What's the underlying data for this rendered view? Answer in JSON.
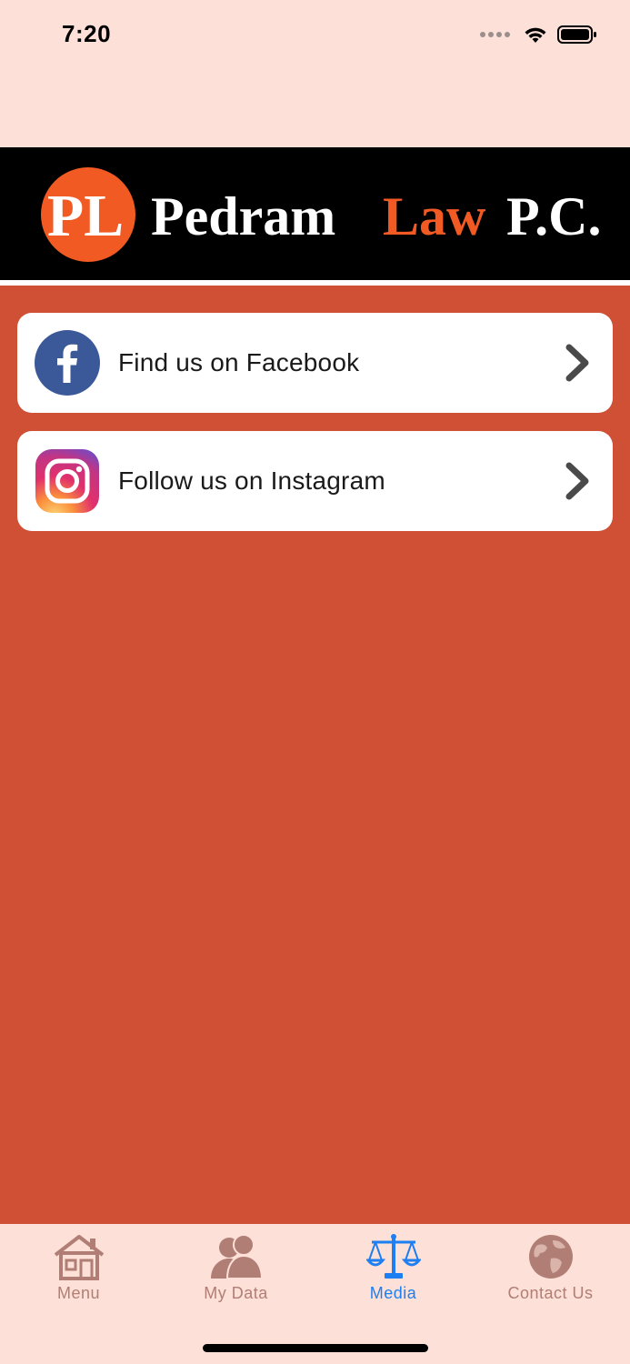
{
  "status_bar": {
    "time": "7:20",
    "icons": [
      "signal-dots-icon",
      "wifi-icon",
      "battery-icon"
    ]
  },
  "header": {
    "logo": {
      "monogram": "PL",
      "word_1": "Pedram",
      "word_2": "Law",
      "word_3": "P.C.",
      "colors": {
        "background": "#000000",
        "accent": "#f15a22",
        "text": "#ffffff"
      }
    }
  },
  "links": [
    {
      "label": "Find us on Facebook",
      "icon": "facebook-icon",
      "trailing_icon": "chevron-right-icon"
    },
    {
      "label": "Follow us on Instagram",
      "icon": "instagram-icon",
      "trailing_icon": "chevron-right-icon"
    }
  ],
  "tab_bar": {
    "items": [
      {
        "label": "Menu",
        "icon": "house-icon",
        "active": false
      },
      {
        "label": "My Data",
        "icon": "people-icon",
        "active": false
      },
      {
        "label": "Media",
        "icon": "scales-icon",
        "active": true
      },
      {
        "label": "Contact Us",
        "icon": "globe-icon",
        "active": false
      }
    ]
  },
  "colors": {
    "page_background": "#fde0d7",
    "content_background": "#cf5034",
    "card_background": "#ffffff",
    "tab_active": "#1d7ff1",
    "tab_inactive": "#b07e74"
  }
}
